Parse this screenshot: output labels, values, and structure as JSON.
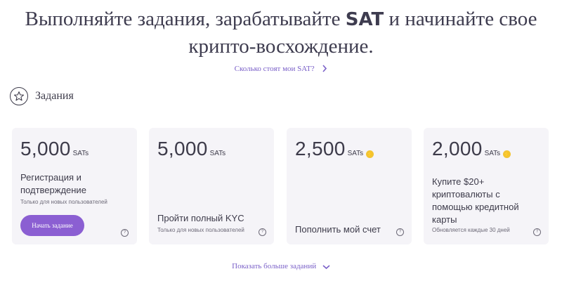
{
  "hero": {
    "title_part1": "Выполняйте задания, зарабатывайте ",
    "title_accent": "SAT",
    "title_part2": " и начинайте свое крипто-восхождение."
  },
  "links": {
    "how_much": "Сколько стоят мои SAT?",
    "show_more": "Показать больше заданий"
  },
  "section": {
    "title": "Задания",
    "icon": "star-icon"
  },
  "cards": [
    {
      "amount": "5,000",
      "unit": "SATs",
      "description": "Регистрация и подтверждение",
      "note": "Только для новых пользователей",
      "button": "Начать задание"
    },
    {
      "amount": "5,000",
      "unit": "SATs",
      "description": "Пройти полный KYC",
      "note": "Только для новых пользователей"
    },
    {
      "amount": "2,500",
      "unit": "SATs",
      "description": "Пополнить мой счет",
      "icon": "lightning-coin-icon"
    },
    {
      "amount": "2,000",
      "unit": "SATs",
      "description": "Купите $20+ криптовалюты с помощью кредитной карты",
      "note": "Обновляется каждые 30 дней",
      "icon": "lightning-coin-icon"
    }
  ],
  "colors": {
    "accent": "#8b5fd2",
    "link": "#7a60c8",
    "card_bg": "#f5f4f8",
    "text": "#3d3b4a",
    "coin": "#f2c433"
  }
}
